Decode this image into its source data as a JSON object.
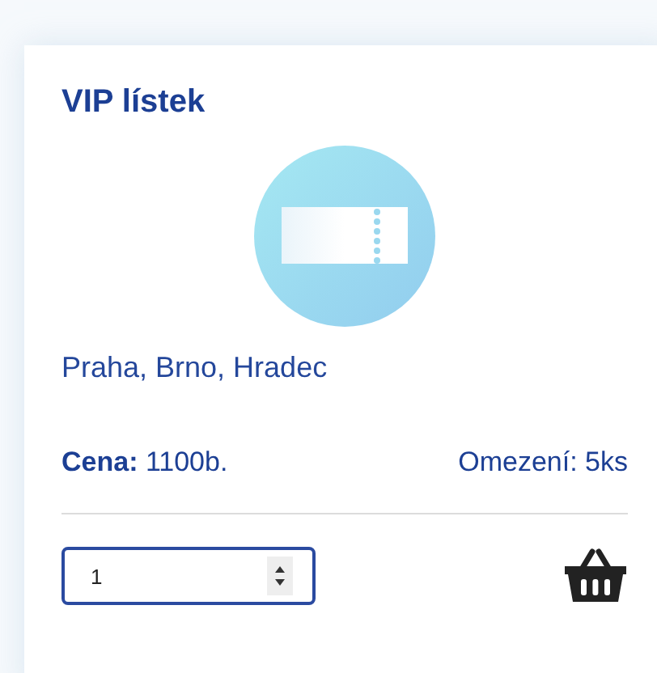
{
  "card": {
    "title": "VIP lístek",
    "locations": "Praha, Brno, Hradec",
    "price": "**Cena:** 1100b.",
    "limit": "Omezení: 5ks",
    "quantity": {
      "value": "1"
    }
  }
}
